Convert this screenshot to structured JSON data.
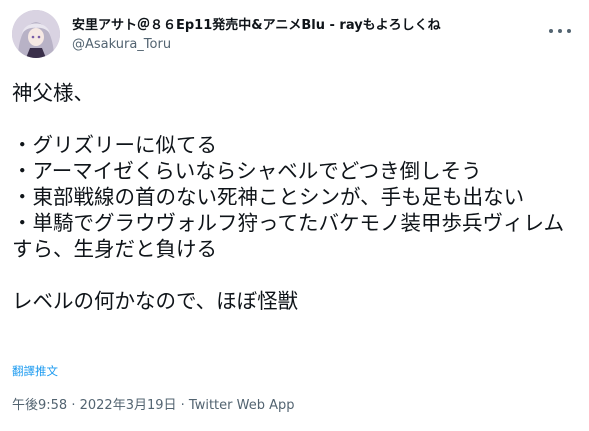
{
  "author": {
    "display_name": "安里アサト＠８６Ep11発売中&アニメBlu - rayもよろしくね",
    "handle": "@Asakura_Toru",
    "avatar_icon": "avatar"
  },
  "more_icon": "more-options-icon",
  "tweet": {
    "text": "神父様、\n\n・グリズリーに似てる\n・アーマイゼくらいならシャベルでどつき倒しそう\n・東部戦線の首のない死神ことシンが、手も足も出ない\n・単騎でグラウヴォルフ狩ってたバケモノ装甲歩兵ヴィレムすら、生身だと負ける\n\nレベルの何かなので、ほぼ怪獣",
    "translate_label": "翻譯推文"
  },
  "meta": {
    "time": "午後9:58",
    "separator": " · ",
    "date": "2022年3月19日",
    "client": "Twitter Web App"
  },
  "colors": {
    "text": "#0f1419",
    "secondary": "#536471",
    "link": "#1d9bf0"
  }
}
